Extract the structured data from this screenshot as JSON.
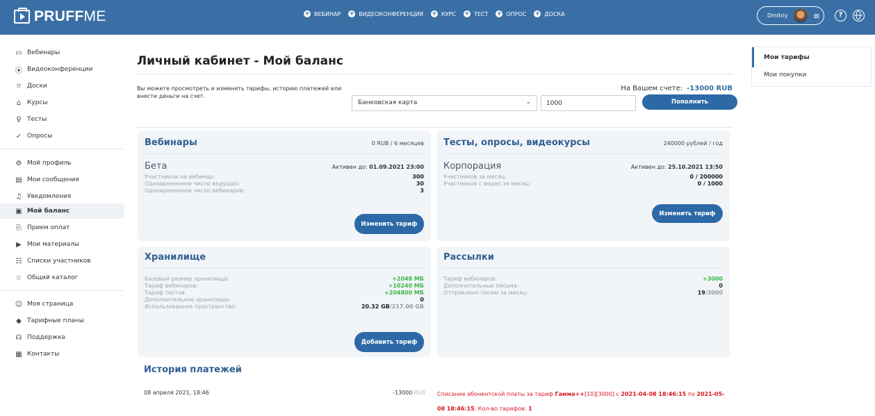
{
  "header": {
    "logo_bold": "PRUFF",
    "logo_light": "ME",
    "create_items": [
      "ВЕБИНАР",
      "ВИДЕОКОНФЕРЕНЦИЯ",
      "КУРС",
      "ТЕСТ",
      "ОПРОС",
      "ДОСКА"
    ],
    "user_name": "Dmitriy",
    "help_icon": "?",
    "lang_icon": "globe"
  },
  "sidebar": {
    "group1": [
      {
        "label": "Вебинары",
        "icon": "webinar-icon",
        "glyph": "▭"
      },
      {
        "label": "Видеоконференции",
        "icon": "radio-waves-icon",
        "glyph": "⦿"
      },
      {
        "label": "Доски",
        "icon": "board-icon",
        "glyph": "⌑"
      },
      {
        "label": "Курсы",
        "icon": "course-icon",
        "glyph": "⌂"
      },
      {
        "label": "Тесты",
        "icon": "bulb-icon",
        "glyph": "♀"
      },
      {
        "label": "Опросы",
        "icon": "check-circle-icon",
        "glyph": "✓"
      }
    ],
    "group2": [
      {
        "label": "Мой профиль",
        "icon": "gear-icon",
        "glyph": "⚙"
      },
      {
        "label": "Мои сообщения",
        "icon": "message-icon",
        "glyph": "▤"
      },
      {
        "label": "Уведомления",
        "icon": "bell-icon",
        "glyph": "♫"
      },
      {
        "label": "Мой баланс",
        "icon": "wallet-icon",
        "glyph": "▣",
        "active": true
      },
      {
        "label": "Прием оплат",
        "icon": "payment-icon",
        "glyph": "⎘"
      },
      {
        "label": "Мои материалы",
        "icon": "play-circle-icon",
        "glyph": "▶"
      },
      {
        "label": "Списки участников",
        "icon": "users-icon",
        "glyph": "☷"
      },
      {
        "label": "Общий каталог",
        "icon": "star-icon",
        "glyph": "☆"
      }
    ],
    "group3": [
      {
        "label": "Моя страница",
        "icon": "user-circle-icon",
        "glyph": "☺"
      },
      {
        "label": "Тарифные планы",
        "icon": "diamond-icon",
        "glyph": "◆"
      },
      {
        "label": "Поддержка",
        "icon": "headset-icon",
        "glyph": "☊"
      },
      {
        "label": "Контакты",
        "icon": "contact-card-icon",
        "glyph": "▦"
      }
    ]
  },
  "main": {
    "title": "Личный кабинет - Мой баланс",
    "intro": "Вы можете просмотреть и изменить тарифы, историю платежей или внести деньги на счет.",
    "balance_label": "На Вашем счете:",
    "balance_value": "-13000 RUB",
    "payment_method": "Банковская карта",
    "amount": "1000",
    "topup_button": "Пополнить"
  },
  "cards": {
    "webinars": {
      "title": "Вебинары",
      "price": "0 RUB / 6 месяцев",
      "plan": "Бета",
      "active_label": "Активен до:",
      "active_date": "01.09.2021 23:00",
      "rows": [
        {
          "label": "Участников на вебинар:",
          "value": "300"
        },
        {
          "label": "Одновременное число ведущих:",
          "value": "30"
        },
        {
          "label": "Одновременное число вебинаров:",
          "value": "3"
        }
      ],
      "button": "Изменить тариф"
    },
    "tests": {
      "title": "Тесты, опросы, видеокурсы",
      "price": "240000 рублей / год",
      "plan": "Корпорация",
      "active_label": "Активен до:",
      "active_date": "25.10.2021 13:50",
      "rows": [
        {
          "label": "Участников за месяц:",
          "value": "0 / 200000"
        },
        {
          "label": "Участников с видео за месяц:",
          "value": "0 / 1000"
        }
      ],
      "button": "Изменить тариф"
    },
    "storage": {
      "title": "Хранилище",
      "rows": [
        {
          "label": "Базовый размер хранилища:",
          "value": "+2048 МБ"
        },
        {
          "label": "Тариф вебинаров:",
          "value": "+10240 МБ"
        },
        {
          "label": "Тариф тестов:",
          "value": "+204800 МБ"
        },
        {
          "label": "Дополнительное хранилище:",
          "value": "0"
        }
      ],
      "used_label": "Использованное пространство:",
      "used_value": "20.32 GB",
      "used_total": "/217.00 GB",
      "button": "Добавить тариф"
    },
    "mailings": {
      "title": "Рассылки",
      "rows": [
        {
          "label": "Тариф вебинаров:",
          "value": "+3000"
        },
        {
          "label": "Дополнительные письма:",
          "value": "0"
        }
      ],
      "sent_label": "Отправлено писем за месяц:",
      "sent_value": "19",
      "sent_total": "/3000"
    }
  },
  "history": {
    "title": "История платежей",
    "date": "08 апреля 2021, 18:46",
    "amount": "-13000",
    "currency": "RUB",
    "desc_prefix": "Списание абонентской платы за тариф ",
    "desc_plan": "Гамма++",
    "desc_params": "[10][3000] с ",
    "desc_from": "2021-04-08 18:46:15",
    "desc_mid": " по ",
    "desc_to": "2021-05-08 18:46:15",
    "desc_count_label": ". Кол-во тарифов: ",
    "desc_count": "1"
  },
  "right_nav": {
    "items": [
      "Мои тарифы",
      "Мои покупки"
    ]
  },
  "colors": {
    "topbar": "#3a6fa6",
    "accent": "#2f5f92",
    "button": "#2d69a6",
    "positive": "#3db54a",
    "negative": "#d71920"
  }
}
